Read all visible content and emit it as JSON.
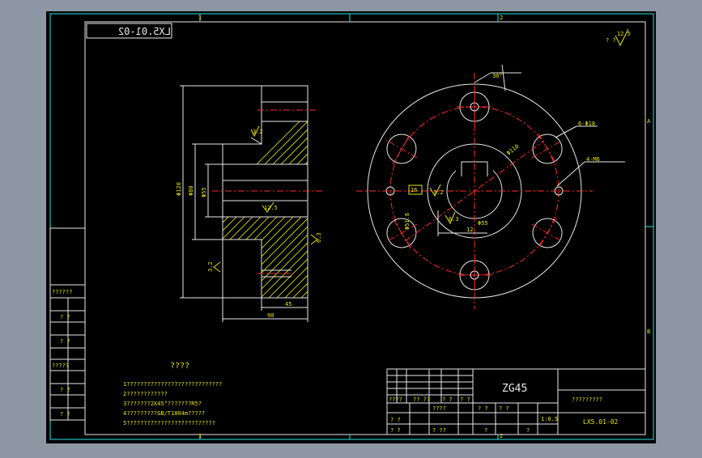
{
  "drawing_no_mirror": "LX5.01-02",
  "title_block": {
    "material": "ZG45",
    "drawing_no": "LX5.01-02",
    "name": "?????????",
    "scale": "1:0.5",
    "sheet_marks": [
      "?",
      "?"
    ],
    "small_cells": [
      "? ?",
      "? ?",
      "????",
      "?? ??",
      "? ?",
      "? ?",
      "????",
      "? ?",
      "? ?",
      "? ??",
      "? ?",
      "? ?"
    ]
  },
  "left_revision_column": [
    "??????",
    "?  ?",
    "?  ?",
    "?????",
    "?  ?",
    "?  ?"
  ],
  "notes": {
    "heading": "????",
    "lines": [
      "1????????????????????????????",
      "2????????????",
      "3???????2X45°???????R5?",
      "4?????????GB/T1804m?????",
      "5??????????????????????????"
    ]
  },
  "border_marks": {
    "top": [
      "1",
      "2"
    ],
    "bottom": [
      "1",
      "2"
    ],
    "right": [
      "A",
      "B"
    ]
  },
  "roughness_top_right": {
    "prefix": "? ?",
    "value": "12.5"
  },
  "dimensions": {
    "section": [
      "Φ120",
      "Φ80",
      "Φ55",
      "45",
      "90",
      "M6",
      "3.2",
      "12.5",
      "6.3",
      "3.2"
    ],
    "front": [
      "30°",
      "Φ110",
      "6-Φ18",
      "4-M6",
      "16",
      "3.2",
      "12",
      "6.3",
      "Φ51.8",
      "Φ55"
    ]
  }
}
